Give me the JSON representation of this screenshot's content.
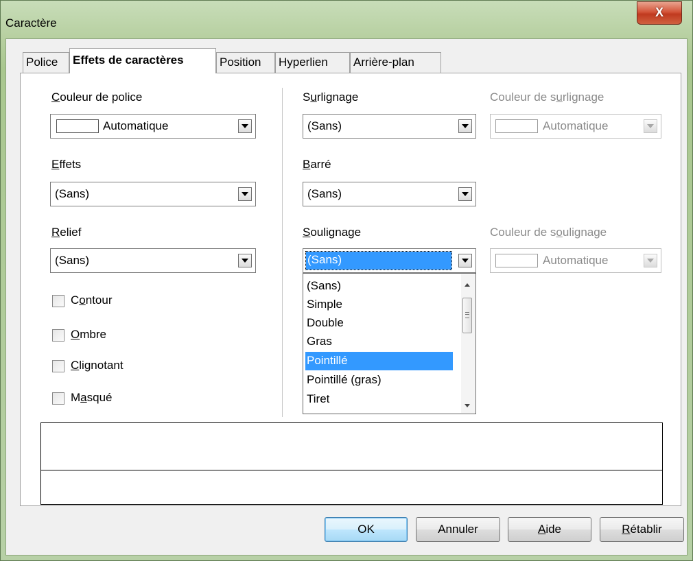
{
  "window": {
    "title": "Caractère",
    "close_glyph": "X"
  },
  "tabs": [
    {
      "label": "Police"
    },
    {
      "label": "Effets de caractères",
      "active": true
    },
    {
      "label": "Position"
    },
    {
      "label": "Hyperlien"
    },
    {
      "label": "Arrière-plan"
    }
  ],
  "left": {
    "font_color": {
      "label_pre": "",
      "label_u": "C",
      "label_post": "ouleur de police",
      "value": "Automatique"
    },
    "effects": {
      "label_u": "E",
      "label_post": "ffets",
      "value": "(Sans)"
    },
    "relief": {
      "label_u": "R",
      "label_post": "elief",
      "value": "(Sans)"
    },
    "checkboxes": [
      {
        "pre": "C",
        "u": "o",
        "post": "ntour",
        "checked": false
      },
      {
        "pre": "",
        "u": "O",
        "post": "mbre",
        "checked": false
      },
      {
        "pre": "",
        "u": "C",
        "post": "lignotant",
        "checked": false
      },
      {
        "pre": "M",
        "u": "a",
        "post": "squé",
        "checked": false
      }
    ]
  },
  "right": {
    "highlight": {
      "pre": "S",
      "u": "u",
      "post": "rlignage",
      "value": "(Sans)"
    },
    "highlight_color": {
      "pre": "Couleur de s",
      "u": "u",
      "post": "rlignage",
      "value": "Automatique",
      "disabled": true
    },
    "strike": {
      "pre": "",
      "u": "B",
      "post": "arré",
      "value": "(Sans)"
    },
    "underline": {
      "pre": "",
      "u": "S",
      "post": "oulignage",
      "value": "(Sans)"
    },
    "underline_color": {
      "pre": "Couleur de s",
      "u": "o",
      "post": "ulignage",
      "value": "Automatique",
      "disabled": true
    },
    "underline_options": [
      "(Sans)",
      "Simple",
      "Double",
      "Gras",
      "Pointillé",
      "Pointillé (gras)",
      "Tiret"
    ],
    "underline_hovered": "Pointillé"
  },
  "buttons": {
    "ok": "OK",
    "cancel": "Annuler",
    "help_u": "A",
    "help_post": "ide",
    "reset_u": "R",
    "reset_post": "établir"
  },
  "colors": {
    "selection": "#3399ff",
    "title_gradient": "#b6cf9f",
    "close_red": "#c03a1f"
  }
}
